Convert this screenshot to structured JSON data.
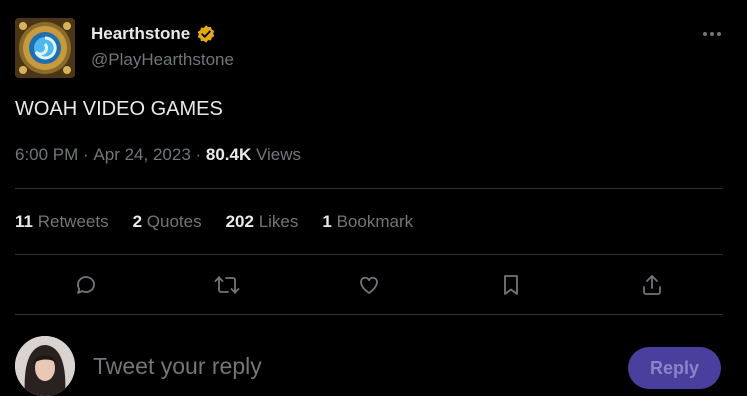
{
  "author": {
    "display_name": "Hearthstone",
    "handle": "@PlayHearthstone",
    "verified_color": "#e2a913"
  },
  "tweet": {
    "text": "WOAH VIDEO GAMES",
    "time": "6:00 PM",
    "separator": " · ",
    "date": "Apr 24, 2023",
    "views_count": "80.4K",
    "views_label": " Views"
  },
  "stats": [
    {
      "count": "11",
      "label": " Retweets"
    },
    {
      "count": "2",
      "label": " Quotes"
    },
    {
      "count": "202",
      "label": " Likes"
    },
    {
      "count": "1",
      "label": " Bookmark"
    }
  ],
  "actions": [
    {
      "icon": "reply-icon"
    },
    {
      "icon": "retweet-icon"
    },
    {
      "icon": "like-icon"
    },
    {
      "icon": "bookmark-icon"
    },
    {
      "icon": "share-icon"
    }
  ],
  "composer": {
    "placeholder": "Tweet your reply",
    "button_label": "Reply"
  }
}
